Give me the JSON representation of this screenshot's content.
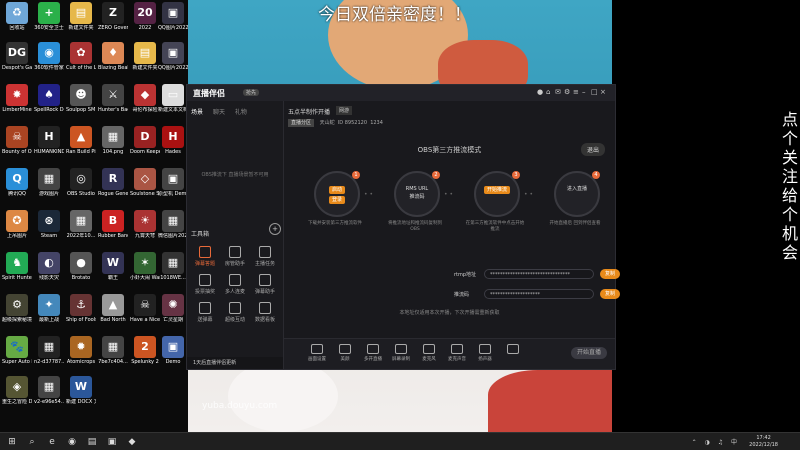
{
  "overlay": {
    "title": "今日双倍亲密度！！",
    "side_text": "点个关注，给个机会",
    "watermark": "yuba.douyu.com"
  },
  "desktop_icons": [
    {
      "label": "回收站",
      "color": "#6fa7d8",
      "glyph": "♻"
    },
    {
      "label": "360安全卫士",
      "color": "#2bb04a",
      "glyph": "+"
    },
    {
      "label": "新建文件夹",
      "color": "#e6b84a",
      "glyph": "▤"
    },
    {
      "label": "ZERO Govern.exe",
      "color": "#222",
      "glyph": "Z"
    },
    {
      "label": "2022",
      "color": "#552244",
      "glyph": "20"
    },
    {
      "label": "QQ图片2022...",
      "color": "#334",
      "glyph": "▣"
    },
    {
      "label": "Despot's Game",
      "color": "#333",
      "glyph": "DG"
    },
    {
      "label": "360软件管家",
      "color": "#2a8fd8",
      "glyph": "◉"
    },
    {
      "label": "Cult of the Lamb",
      "color": "#a33",
      "glyph": "✿"
    },
    {
      "label": "Blazing Beaks",
      "color": "#d85",
      "glyph": "♦"
    },
    {
      "label": "新建文件夹",
      "color": "#e6b84a",
      "glyph": "▤"
    },
    {
      "label": "QQ图片2022...",
      "color": "#445",
      "glyph": "▣"
    },
    {
      "label": "LimberMine",
      "color": "#c33",
      "glyph": "✸"
    },
    {
      "label": "SpellRock Demonic...",
      "color": "#228",
      "glyph": "♠"
    },
    {
      "label": "Soulpop SM breakers",
      "color": "#555",
      "glyph": "☻"
    },
    {
      "label": "Hunter's Backpack",
      "color": "#444",
      "glyph": "⚔"
    },
    {
      "label": "哥伦布探险",
      "color": "#b33",
      "glyph": "◆"
    },
    {
      "label": "新建文本文档",
      "color": "#ddd",
      "glyph": "▭"
    },
    {
      "label": "Bounty of One",
      "color": "#a42",
      "glyph": "☠"
    },
    {
      "label": "HUMANKIND",
      "color": "#222",
      "glyph": "H"
    },
    {
      "label": "Ran Build Pixel",
      "color": "#c52",
      "glyph": "▲"
    },
    {
      "label": "104.png",
      "color": "#666",
      "glyph": "▦"
    },
    {
      "label": "Doom Keeper",
      "color": "#922",
      "glyph": "D"
    },
    {
      "label": "Hades",
      "color": "#a11",
      "glyph": "H"
    },
    {
      "label": "腾讯QQ",
      "color": "#2a8fd8",
      "glyph": "Q"
    },
    {
      "label": "游戏图片",
      "color": "#444",
      "glyph": "▦"
    },
    {
      "label": "OBS Studio",
      "color": "#222",
      "glyph": "◎"
    },
    {
      "label": "Rogue Genesia",
      "color": "#335",
      "glyph": "R"
    },
    {
      "label": "Soulstone Survivors",
      "color": "#a54",
      "glyph": "◇"
    },
    {
      "label": "原型机 Demo",
      "color": "#444",
      "glyph": "▣"
    },
    {
      "label": "上吊图片",
      "color": "#d84",
      "glyph": "✪"
    },
    {
      "label": "Steam",
      "color": "#1b2838",
      "glyph": "⊛"
    },
    {
      "label": "2022年10...",
      "color": "#666",
      "glyph": "▦"
    },
    {
      "label": "Rubber Bandits",
      "color": "#c22",
      "glyph": "B"
    },
    {
      "label": "九霄天穹",
      "color": "#a33",
      "glyph": "☀"
    },
    {
      "label": "微信图片2022...",
      "color": "#444",
      "glyph": "▦"
    },
    {
      "label": "Spirit Hunter",
      "color": "#2a5",
      "glyph": "♞"
    },
    {
      "label": "残影天灾",
      "color": "#446",
      "glyph": "◐"
    },
    {
      "label": "Brotato",
      "color": "#555",
      "glyph": "●"
    },
    {
      "label": "霸王",
      "color": "#335",
      "glyph": "W"
    },
    {
      "label": "小虾大闹 Warpips",
      "color": "#363",
      "glyph": "✶"
    },
    {
      "label": "1018WE...",
      "color": "#333",
      "glyph": "▦"
    },
    {
      "label": "超级探索秘境 Project Zero",
      "color": "#443",
      "glyph": "⚙"
    },
    {
      "label": "最新上战",
      "color": "#48b",
      "glyph": "✦"
    },
    {
      "label": "Ship of Fools",
      "color": "#633",
      "glyph": "⚓"
    },
    {
      "label": "Bad North",
      "color": "#999",
      "glyph": "▲"
    },
    {
      "label": "Have a Nice Death",
      "color": "#222",
      "glyph": "☠"
    },
    {
      "label": "亡灵星期",
      "color": "#634",
      "glyph": "✺"
    },
    {
      "label": "Super Auto Pets",
      "color": "#6a4",
      "glyph": "🐾"
    },
    {
      "label": "n2-d37787...",
      "color": "#222",
      "glyph": "▦"
    },
    {
      "label": "Atomicrops",
      "color": "#a62",
      "glyph": "✹"
    },
    {
      "label": "7be7c404...",
      "color": "#444",
      "glyph": "▦"
    },
    {
      "label": "Spelunky 2",
      "color": "#c52",
      "glyph": "2"
    },
    {
      "label": "Demo",
      "color": "#46a",
      "glyph": "▣"
    },
    {
      "label": "重生之冒险 Demo",
      "color": "#553",
      "glyph": "◈"
    },
    {
      "label": "v2-e96e54...",
      "color": "#444",
      "glyph": "▦"
    },
    {
      "label": "新建 DOCX 文档",
      "color": "#2b579a",
      "glyph": "W"
    }
  ],
  "app": {
    "logo": "直播伴侣",
    "version_badge": "抢先",
    "left_tabs": [
      "场景",
      "聊天",
      "礼物"
    ],
    "empty_text": "OBS推流下 直播场景暂不可用",
    "toolbox_title": "工具箱",
    "toolbox_add": "+",
    "tools": [
      {
        "label": "弹幕答题",
        "active": true
      },
      {
        "label": "房管助手",
        "active": false
      },
      {
        "label": "主播任务",
        "active": false
      },
      {
        "label": "投票抽奖",
        "active": false
      },
      {
        "label": "多人连麦",
        "active": false
      },
      {
        "label": "弹幕助手",
        "active": false
      },
      {
        "label": "送弹幕",
        "active": false
      },
      {
        "label": "超级互动",
        "active": false
      },
      {
        "label": "数据看板",
        "active": false
      }
    ],
    "bottom_notice": "1天后直播伴侣更新",
    "room_title": "五点半制作开播",
    "room_tag": "网游",
    "room_category": "直播分区",
    "room_stats": [
      "天山蛇",
      "ID 8952120",
      "1234"
    ],
    "obs_title": "OBS第三方推流模式",
    "exit_label": "退出",
    "steps": [
      {
        "num": "1",
        "lines": [
          "启动",
          "登录"
        ],
        "desc": "下载并安装第三方推流软件"
      },
      {
        "num": "2",
        "lines": [
          "RMS URL",
          "推流码"
        ],
        "desc": "将推流地址和推流码复制到OBS"
      },
      {
        "num": "3",
        "lines": [
          "开始推流"
        ],
        "desc": "在第三方推流软件中点击开始推流"
      },
      {
        "num": "4",
        "lines": [
          "进入直播"
        ],
        "desc": "开始直播后 回到伴侣查看"
      }
    ],
    "rtmp_label": "rtmp地址",
    "rtmp_value": "********************************",
    "stream_key_label": "推流码",
    "stream_key_value": "********************",
    "copy_label": "复制",
    "hint": "本地址仅适用本次开播，下次开播需重新获取",
    "bottom_tools": [
      "画面设置",
      "美颜",
      "多开直播",
      "屏幕录制",
      "麦克风",
      "麦克声音",
      "扬声器",
      ""
    ],
    "start_label": "开始直播"
  },
  "taskbar": {
    "time": "17:42",
    "date": "2022/12/18"
  }
}
